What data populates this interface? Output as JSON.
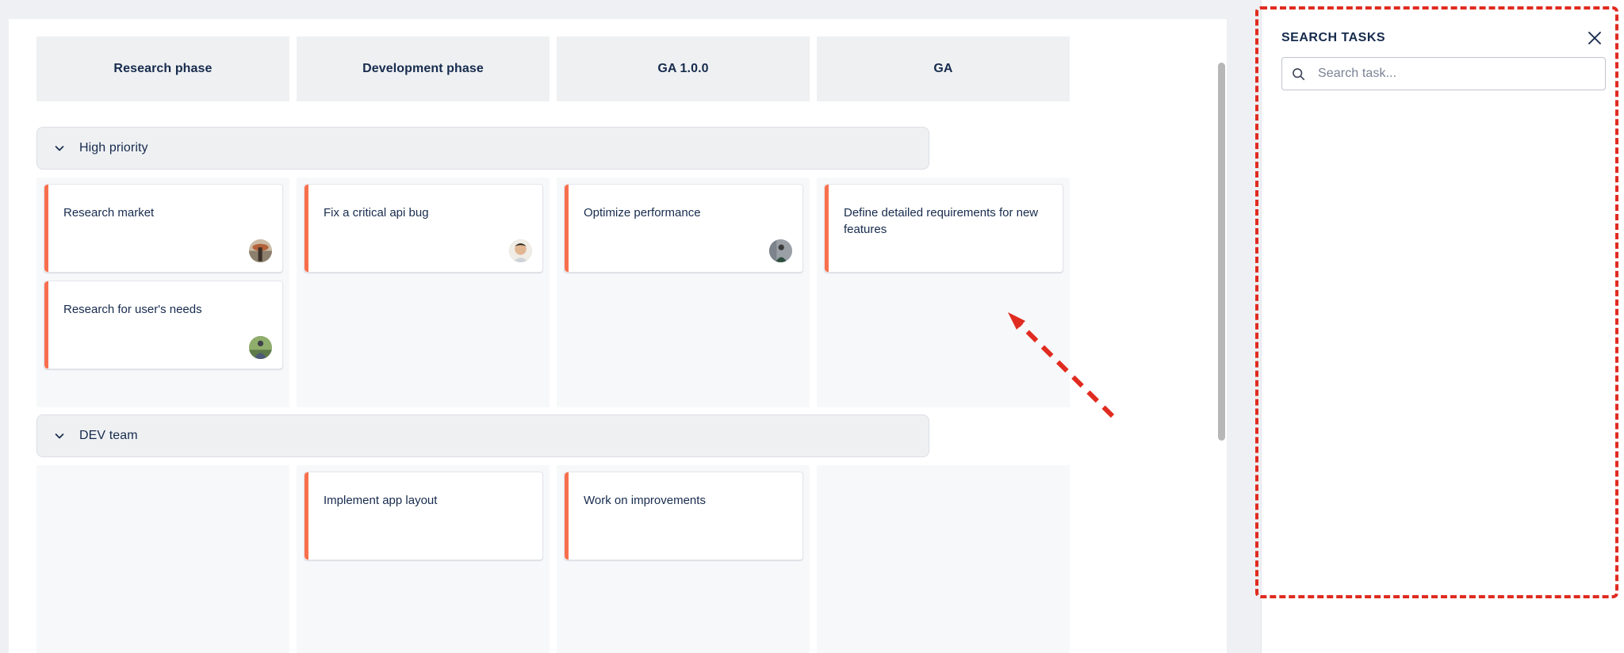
{
  "board": {
    "columns": [
      {
        "label": "Research phase"
      },
      {
        "label": "Development phase"
      },
      {
        "label": "GA 1.0.0"
      },
      {
        "label": "GA"
      }
    ],
    "groups": [
      {
        "label": "High priority",
        "chevron_icon": "chevron-down-icon",
        "cells": [
          {
            "cards": [
              {
                "title": "Research market",
                "avatar_icon": "avatar-image",
                "highlighted": false
              },
              {
                "title": "Research for user's needs",
                "avatar_icon": "avatar-image",
                "highlighted": false
              }
            ]
          },
          {
            "cards": [
              {
                "title": "Fix a critical api bug",
                "avatar_icon": "avatar-image",
                "highlighted": false
              }
            ]
          },
          {
            "cards": [
              {
                "title": "Optimize performance",
                "avatar_icon": "avatar-image",
                "highlighted": true
              }
            ]
          },
          {
            "cards": [
              {
                "title": "Define detailed requirements for new features",
                "avatar_icon": "",
                "highlighted": false
              }
            ]
          }
        ]
      },
      {
        "label": "DEV team",
        "chevron_icon": "chevron-down-icon",
        "cells": [
          {
            "cards": []
          },
          {
            "cards": [
              {
                "title": "Implement app layout",
                "avatar_icon": "",
                "highlighted": false
              }
            ]
          },
          {
            "cards": [
              {
                "title": "Work on improvements",
                "avatar_icon": "",
                "highlighted": false
              }
            ]
          },
          {
            "cards": []
          }
        ]
      }
    ],
    "scrollbar_icon": "vertical-scrollbar"
  },
  "search_panel": {
    "title": "SEARCH TASKS",
    "close_icon": "close-icon",
    "search_icon": "search-icon",
    "search_value": "",
    "search_placeholder": "Search task...",
    "results": []
  },
  "annotations": {
    "arrow_icon": "pointer-arrow",
    "highlight_color": "#e02b20"
  },
  "colors": {
    "accent_orange": "#f86f4d",
    "text_primary": "#172b4d",
    "panel_surface": "#eef0f2",
    "lane_surface": "#f7f8f9",
    "highlight_red": "#e02b20"
  }
}
